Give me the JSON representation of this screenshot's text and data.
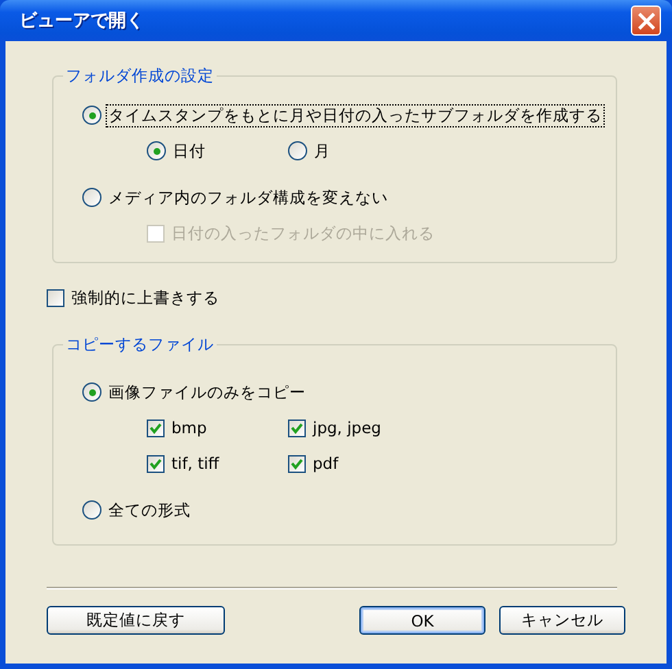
{
  "window": {
    "title": "ビューアで開く"
  },
  "folder_group": {
    "title": "フォルダ作成の設定",
    "options": [
      {
        "label": "タイムスタンプをもとに月や日付の入ったサブフォルダを作成する",
        "selected": true,
        "focused": true,
        "children": [
          {
            "kind": "radio",
            "label": "日付",
            "selected": true
          },
          {
            "kind": "radio",
            "label": "月",
            "selected": false
          }
        ]
      },
      {
        "label": "メディア内のフォルダ構成を変えない",
        "selected": false,
        "focused": false,
        "children": [
          {
            "kind": "checkbox",
            "label": "日付の入ったフォルダの中に入れる",
            "checked": false,
            "disabled": true
          }
        ]
      }
    ]
  },
  "overwrite": {
    "label": "強制的に上書きする",
    "checked": false
  },
  "copy_group": {
    "title": "コピーするファイル",
    "options": [
      {
        "label": "画像ファイルのみをコピー",
        "selected": true,
        "focused": false,
        "children": [
          {
            "kind": "checkbox",
            "label": "bmp",
            "checked": true,
            "disabled": false
          },
          {
            "kind": "checkbox",
            "label": "jpg, jpeg",
            "checked": true,
            "disabled": false
          },
          {
            "kind": "checkbox",
            "label": "tif, tiff",
            "checked": true,
            "disabled": false
          },
          {
            "kind": "checkbox",
            "label": "pdf",
            "checked": true,
            "disabled": false
          }
        ]
      },
      {
        "label": "全ての形式",
        "selected": false,
        "focused": false
      }
    ]
  },
  "buttons": [
    {
      "label": "既定値に戻す",
      "default": false
    },
    {
      "label": "OK",
      "default": true
    },
    {
      "label": "キャンセル",
      "default": false
    }
  ]
}
